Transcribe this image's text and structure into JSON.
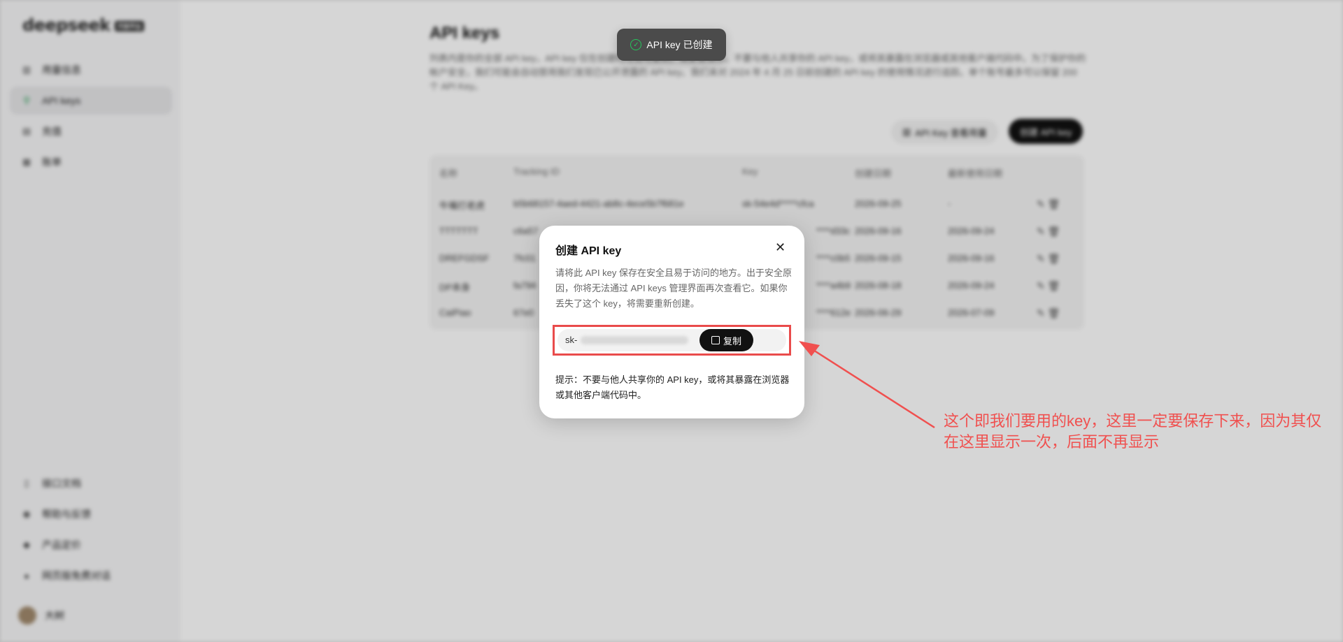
{
  "sidebar": {
    "logo": "deepseek",
    "logo_badge": "开放平台",
    "top_items": [
      {
        "label": "用量信息",
        "icon": "bar-chart-icon"
      },
      {
        "label": "API keys",
        "icon": "search-key-icon",
        "active": true
      },
      {
        "label": "充值",
        "icon": "wallet-icon"
      },
      {
        "label": "账单",
        "icon": "receipt-icon"
      }
    ],
    "bottom_items": [
      {
        "label": "接口文档",
        "icon": "document-icon"
      },
      {
        "label": "帮助与反馈",
        "icon": "help-icon"
      },
      {
        "label": "产品定价",
        "icon": "price-tag-icon"
      },
      {
        "label": "网页版免费对话",
        "icon": "chat-icon"
      }
    ],
    "user_name": "大树"
  },
  "main": {
    "title": "API keys",
    "description": "列表内是你的全部 API key，API key 仅在创建时可见可复制，请妥善保存。不要与他人共享你的 API key，或将其暴露在浏览器或其他客户端代码中。为了保护你的帐户安全，我们可能会自动禁用我们发现已公开泄露的 API key。我们未对 2024 年 4 月 25 日前创建的 API key 的使用情况进行追踪。单个账号最多可以保留 200 个 API Key。",
    "usage_button": "API Key 查看用量",
    "create_button": "创建 API key",
    "table": {
      "headers": [
        "名称",
        "Tracking ID",
        "Key",
        "创建日期",
        "最新使用日期"
      ],
      "rows": [
        {
          "name": "牛嘴打老虎",
          "tracking": "b5b68157-4aed-4421-ab8c-4ece5b7f681e",
          "key": "sk-54e4d*****cfca",
          "created": "2026-09-25",
          "last_used": "-"
        },
        {
          "name": "TTTTTTT",
          "tracking": "c6a57",
          "key": "****d33c",
          "created": "2026-09-16",
          "last_used": "2026-09-24"
        },
        {
          "name": "DREFGDSF",
          "tracking": "7fc01",
          "key": "****c0b5",
          "created": "2026-09-15",
          "last_used": "2026-09-16"
        },
        {
          "name": "DP本身",
          "tracking": "fa794",
          "key": "****a4b9",
          "created": "2026-08-18",
          "last_used": "2026-09-24"
        },
        {
          "name": "CaiPiao",
          "tracking": "67e0",
          "key": "****612e",
          "created": "2026-06-29",
          "last_used": "2026-07-09"
        }
      ]
    }
  },
  "toast": {
    "text": "API key 已创建"
  },
  "modal": {
    "title": "创建 API key",
    "close_glyph": "✕",
    "description": "请将此 API key 保存在安全且易于访问的地方。出于安全原因，你将无法通过 API keys 管理界面再次查看它。如果你丢失了这个 key，将需要重新创建。",
    "key_prefix": "sk-",
    "copy_label": "复制",
    "tip": "提示：不要与他人共享你的 API key，或将其暴露在浏览器或其他客户端代码中。"
  },
  "annotation": {
    "text": "这个即我们要用的key，这里一定要保存下来，因为其仅在这里显示一次，后面不再显示",
    "color": "#f0504f"
  }
}
